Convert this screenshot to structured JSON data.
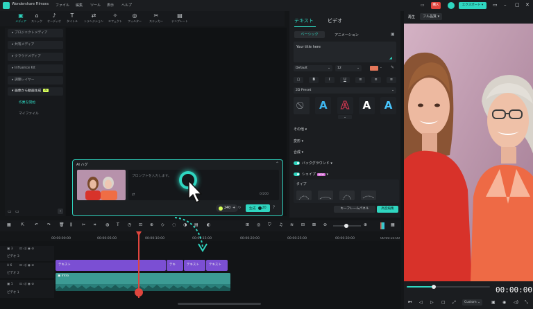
{
  "titlebar": {
    "app_name": "Wondershare Filmora",
    "menus": [
      "ファイル",
      "編集",
      "ツール",
      "表示",
      "ヘルプ"
    ],
    "buy_label": "購入",
    "export_label": "エクスポート"
  },
  "toolbar": {
    "items": [
      {
        "label": "メディア",
        "icon": "media-icon",
        "glyph": "▣"
      },
      {
        "label": "ストック",
        "icon": "stock-icon",
        "glyph": "⌂"
      },
      {
        "label": "オーディオ",
        "icon": "audio-icon",
        "glyph": "♪"
      },
      {
        "label": "タイトル",
        "icon": "title-icon",
        "glyph": "T"
      },
      {
        "label": "トランジション",
        "icon": "transition-icon",
        "glyph": "⇄"
      },
      {
        "label": "エフェクト",
        "icon": "effect-icon",
        "glyph": "✧"
      },
      {
        "label": "フィルター",
        "icon": "filter-icon",
        "glyph": "◎"
      },
      {
        "label": "ステッカー",
        "icon": "sticker-icon",
        "glyph": "✂"
      },
      {
        "label": "テンプレート",
        "icon": "template-icon",
        "glyph": "▤"
      }
    ]
  },
  "sidebar": {
    "items": [
      "プロジェクトメディア",
      "共有メディア",
      "クラウドメディア",
      "Influence Kit",
      "調整レイヤー"
    ],
    "expanded": "画像から動画生成",
    "expanded_badge": "AI",
    "children": [
      "作業を開始",
      "マイファイル"
    ]
  },
  "ai_hug": {
    "title": "AI ハグ",
    "placeholder": "プロンプトを入力します。",
    "counter": "0/200",
    "credits": "240",
    "generate_label": "生成",
    "generate_cost": "20"
  },
  "text_panel": {
    "tabs": [
      "テキスト",
      "ビデオ"
    ],
    "subtabs": [
      "ベーシック",
      "アニメーション"
    ],
    "text_value": "Your title here",
    "font": "Default",
    "size": "12",
    "accent_color": "#e5775a",
    "preset_label": "2D Preset",
    "sections": [
      "その他",
      "変形",
      "合成"
    ],
    "background_label": "バックグラウンド",
    "shape_label": "シェイプ",
    "shape_badge": "NEW",
    "type_label": "タイプ",
    "keyframe_label": "キーフレームパネル",
    "advanced_label": "高度編集"
  },
  "player": {
    "tabs": [
      "再生",
      "フル品質"
    ],
    "timecode": "00:00:00:",
    "zoom": "Custom"
  },
  "timeline": {
    "ruler": [
      "00:00:00:00",
      "00:00:05:00",
      "00:00:10:00",
      "00:00:15:00",
      "00:00:20:00",
      "00:00:25:00",
      "00:00:30:00",
      "00:00:35:00",
      "00:00:40:00",
      "00:00:45:00"
    ],
    "tracks": [
      {
        "num": "3",
        "name": "ビデオ 3"
      },
      {
        "num": "6",
        "name": "ビデオ 2"
      },
      {
        "num": "1",
        "name": "ビデオ 1"
      }
    ],
    "title_clips": [
      "テキスト",
      "テキ",
      "テキスト",
      "テキスト"
    ],
    "video_clip": "Intro"
  }
}
